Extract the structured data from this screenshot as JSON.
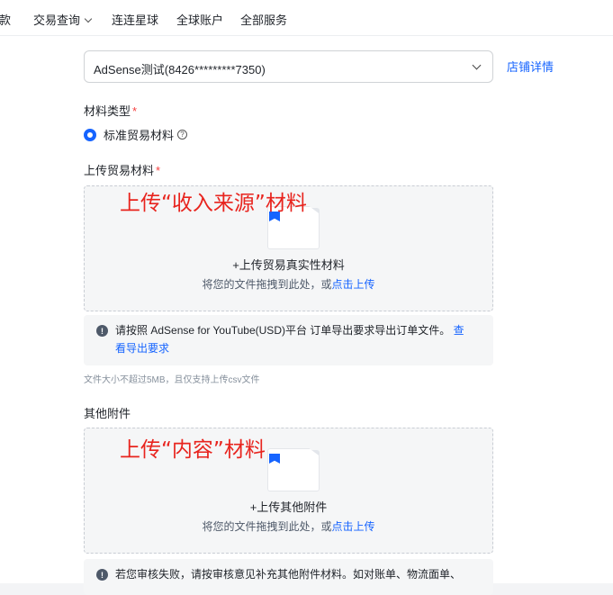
{
  "nav": {
    "items": [
      "款",
      "交易查询",
      "连连星球",
      "全球账户",
      "全部服务"
    ]
  },
  "form": {
    "account_value": "AdSense测试(8426*********7350)",
    "store_link": "店铺详情",
    "material_type_label": "材料类型",
    "material_type_option": "标准贸易材料",
    "required_mark": "*",
    "upload_trade_label": "上传贸易材料",
    "overlay_income": "上传“收入来源”材料",
    "trade_upload_title": "+上传贸易真实性材料",
    "drag_text": "将您的文件拖拽到此处，或",
    "click_upload": "点击上传",
    "info1_text": "请按照 AdSense for YouTube(USD)平台 订单导出要求导出订单文件。",
    "info1_link_a": "查",
    "info1_link_b": "看导出要求",
    "size_hint": "文件大小不超过5MB，且仅支持上传csv文件",
    "other_label": "其他附件",
    "overlay_content": "上传“内容”材料",
    "other_upload_title": "+上传其他附件",
    "drag_text2": "将您的文件拖拽到此处，或",
    "click_upload2": "点击上传",
    "info2_text": "若您审核失败，请按审核意见补充其他附件材料。如对账单、物流面单、"
  },
  "colors": {
    "accent": "#1664ff",
    "required": "#f53f3f",
    "annotation": "#e8241e"
  }
}
